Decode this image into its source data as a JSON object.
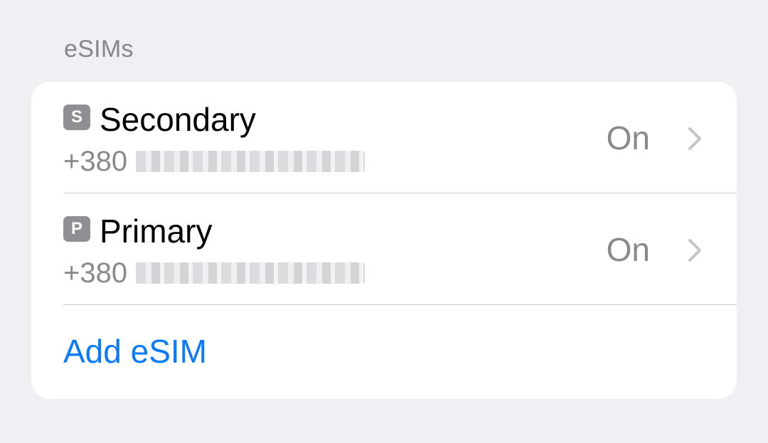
{
  "section": {
    "header": "eSIMs"
  },
  "lines": [
    {
      "badge": "S",
      "name": "Secondary",
      "number_prefix": "+380",
      "status": "On"
    },
    {
      "badge": "P",
      "name": "Primary",
      "number_prefix": "+380",
      "status": "On"
    }
  ],
  "actions": {
    "add_esim": "Add eSIM"
  },
  "colors": {
    "background": "#efeff4",
    "card": "#ffffff",
    "accent": "#0a7aff",
    "secondary_text": "#8a8a8e",
    "badge": "#8e8e93"
  }
}
